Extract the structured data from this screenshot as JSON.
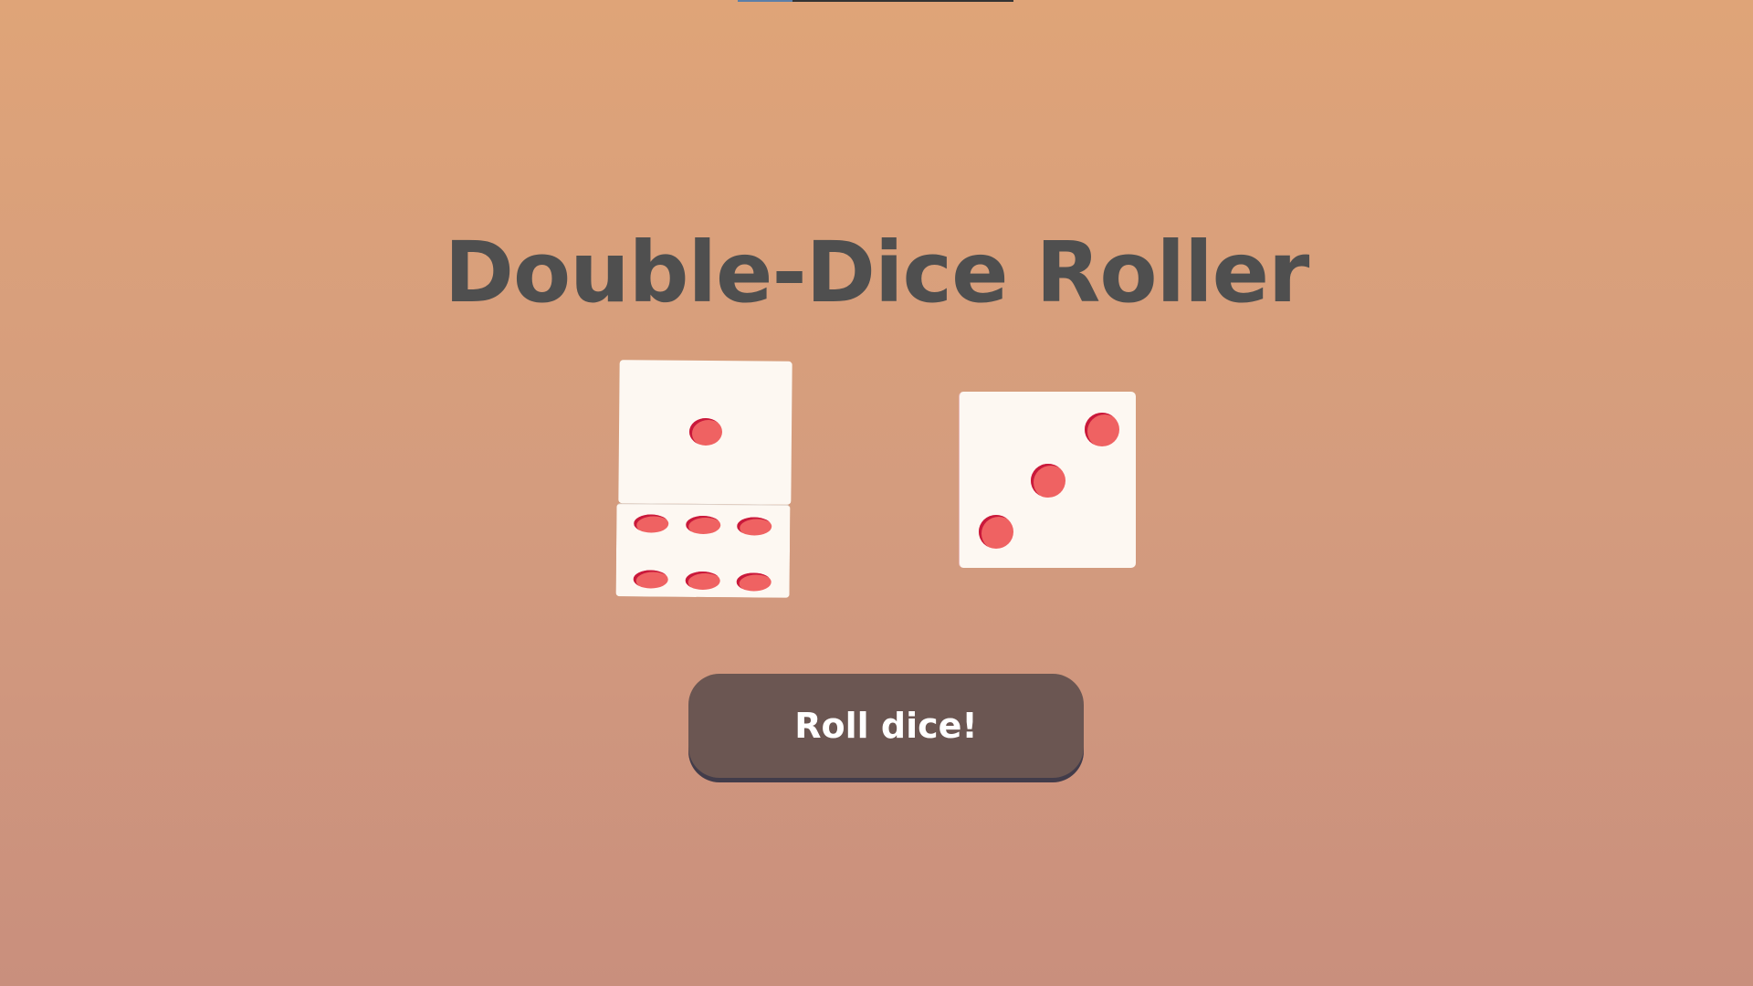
{
  "app": {
    "title": "Double-Dice Roller"
  },
  "dice": {
    "left_die_visible_faces": [
      1,
      6
    ],
    "right_die_value": 3
  },
  "controls": {
    "roll_label": "Roll dice!"
  },
  "colors": {
    "background_top": "#dfa478",
    "background_bottom": "#c98f7d",
    "title": "#4f4f4f",
    "die_face": "#fdf8f2",
    "pip": "#ef6262",
    "pip_shadow": "#c9193b",
    "button": "#6b5652",
    "button_text": "#ffffff"
  }
}
